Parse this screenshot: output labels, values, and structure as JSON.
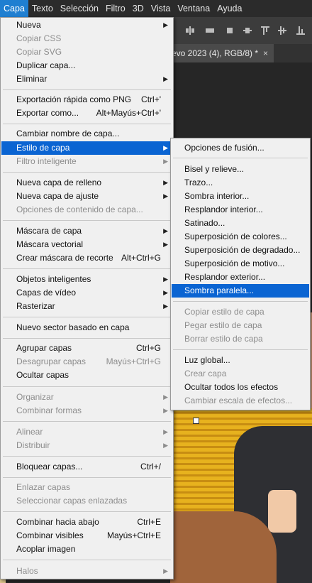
{
  "menubar": {
    "items": [
      "Capa",
      "Texto",
      "Selección",
      "Filtro",
      "3D",
      "Vista",
      "Ventana",
      "Ayuda"
    ]
  },
  "document": {
    "tab_title": "evo 2023 (4), RGB/8) *",
    "close_glyph": "×"
  },
  "menu": {
    "items": [
      {
        "label": "Nueva",
        "submenu": true
      },
      {
        "label": "Copiar CSS",
        "disabled": true
      },
      {
        "label": "Copiar SVG",
        "disabled": true
      },
      {
        "label": "Duplicar capa..."
      },
      {
        "label": "Eliminar",
        "submenu": true
      },
      {
        "label": "Exportación rápida como PNG",
        "shortcut": "Ctrl+'"
      },
      {
        "label": "Exportar como...",
        "shortcut": "Alt+Mayús+Ctrl+'"
      },
      {
        "label": "Cambiar nombre de capa..."
      },
      {
        "label": "Estilo de capa",
        "submenu": true,
        "highlighted": true
      },
      {
        "label": "Filtro inteligente",
        "submenu": true,
        "disabled": true
      },
      {
        "label": "Nueva capa de relleno",
        "submenu": true
      },
      {
        "label": "Nueva capa de ajuste",
        "submenu": true
      },
      {
        "label": "Opciones de contenido de capa...",
        "disabled": true
      },
      {
        "label": "Máscara de capa",
        "submenu": true
      },
      {
        "label": "Máscara vectorial",
        "submenu": true
      },
      {
        "label": "Crear máscara de recorte",
        "shortcut": "Alt+Ctrl+G"
      },
      {
        "label": "Objetos inteligentes",
        "submenu": true
      },
      {
        "label": "Capas de vídeo",
        "submenu": true
      },
      {
        "label": "Rasterizar",
        "submenu": true
      },
      {
        "label": "Nuevo sector basado en capa"
      },
      {
        "label": "Agrupar capas",
        "shortcut": "Ctrl+G"
      },
      {
        "label": "Desagrupar capas",
        "shortcut": "Mayús+Ctrl+G",
        "disabled": true
      },
      {
        "label": "Ocultar capas"
      },
      {
        "label": "Organizar",
        "submenu": true,
        "disabled": true
      },
      {
        "label": "Combinar formas",
        "submenu": true,
        "disabled": true
      },
      {
        "label": "Alinear",
        "submenu": true,
        "disabled": true
      },
      {
        "label": "Distribuir",
        "submenu": true,
        "disabled": true
      },
      {
        "label": "Bloquear capas...",
        "shortcut": "Ctrl+/"
      },
      {
        "label": "Enlazar capas",
        "disabled": true
      },
      {
        "label": "Seleccionar capas enlazadas",
        "disabled": true
      },
      {
        "label": "Combinar hacia abajo",
        "shortcut": "Ctrl+E"
      },
      {
        "label": "Combinar visibles",
        "shortcut": "Mayús+Ctrl+E"
      },
      {
        "label": "Acoplar imagen"
      },
      {
        "label": "Halos",
        "submenu": true,
        "disabled": true
      }
    ]
  },
  "submenu": {
    "items": [
      {
        "label": "Opciones de fusión..."
      },
      {
        "label": "Bisel y relieve..."
      },
      {
        "label": "Trazo..."
      },
      {
        "label": "Sombra interior..."
      },
      {
        "label": "Resplandor interior..."
      },
      {
        "label": "Satinado..."
      },
      {
        "label": "Superposición de colores..."
      },
      {
        "label": "Superposición de degradado..."
      },
      {
        "label": "Superposición de motivo..."
      },
      {
        "label": "Resplandor exterior..."
      },
      {
        "label": "Sombra paralela...",
        "highlighted": true
      },
      {
        "label": "Copiar estilo de capa",
        "disabled": true
      },
      {
        "label": "Pegar estilo de capa",
        "disabled": true
      },
      {
        "label": "Borrar estilo de capa",
        "disabled": true
      },
      {
        "label": "Luz global..."
      },
      {
        "label": "Crear capa",
        "disabled": true
      },
      {
        "label": "Ocultar todos los efectos"
      },
      {
        "label": "Cambiar escala de efectos...",
        "disabled": true
      }
    ]
  },
  "icons": {
    "submenu_arrow": "chevron-right-icon",
    "doc_close": "close-icon"
  },
  "colors": {
    "menu_bg": "#f0f0f0",
    "highlight": "#0a64d2",
    "menubar_bg": "#2b2b2b",
    "disabled_text": "#8d8d8d"
  }
}
